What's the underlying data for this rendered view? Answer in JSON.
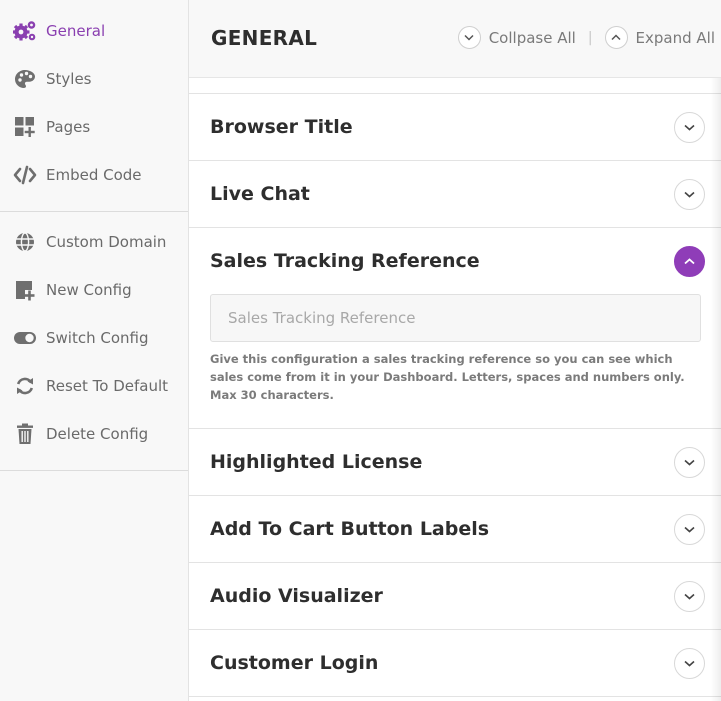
{
  "sidebar": {
    "items": [
      {
        "label": "General",
        "icon": "gears-icon",
        "active": true
      },
      {
        "label": "Styles",
        "icon": "palette-icon"
      },
      {
        "label": "Pages",
        "icon": "pages-grid-icon"
      },
      {
        "label": "Embed Code",
        "icon": "code-icon"
      }
    ],
    "config_items": [
      {
        "label": "Custom Domain",
        "icon": "globe-icon"
      },
      {
        "label": "New Config",
        "icon": "new-config-icon"
      },
      {
        "label": "Switch Config",
        "icon": "toggle-icon"
      },
      {
        "label": "Reset To Default",
        "icon": "refresh-icon"
      },
      {
        "label": "Delete Config",
        "icon": "trash-icon"
      }
    ]
  },
  "header": {
    "title": "GENERAL",
    "collapse_label": "Collpase All",
    "separator": "|",
    "expand_label": "Expand All"
  },
  "sections": [
    {
      "title": "Browser Title",
      "expanded": false
    },
    {
      "title": "Live Chat",
      "expanded": false
    },
    {
      "title": "Sales Tracking Reference",
      "expanded": true
    },
    {
      "title": "Highlighted License",
      "expanded": false
    },
    {
      "title": "Add To Cart Button Labels",
      "expanded": false
    },
    {
      "title": "Audio Visualizer",
      "expanded": false
    },
    {
      "title": "Customer Login",
      "expanded": false
    }
  ],
  "sales_tracking": {
    "input_value": "",
    "placeholder": "Sales Tracking Reference",
    "help_text": "Give this configuration a sales tracking reference so you can see which sales come from it in your Dashboard. Letters, spaces and numbers only. Max 30 characters."
  },
  "colors": {
    "accent": "#8f3db8",
    "sidebar_bg": "#f8f8f8"
  }
}
